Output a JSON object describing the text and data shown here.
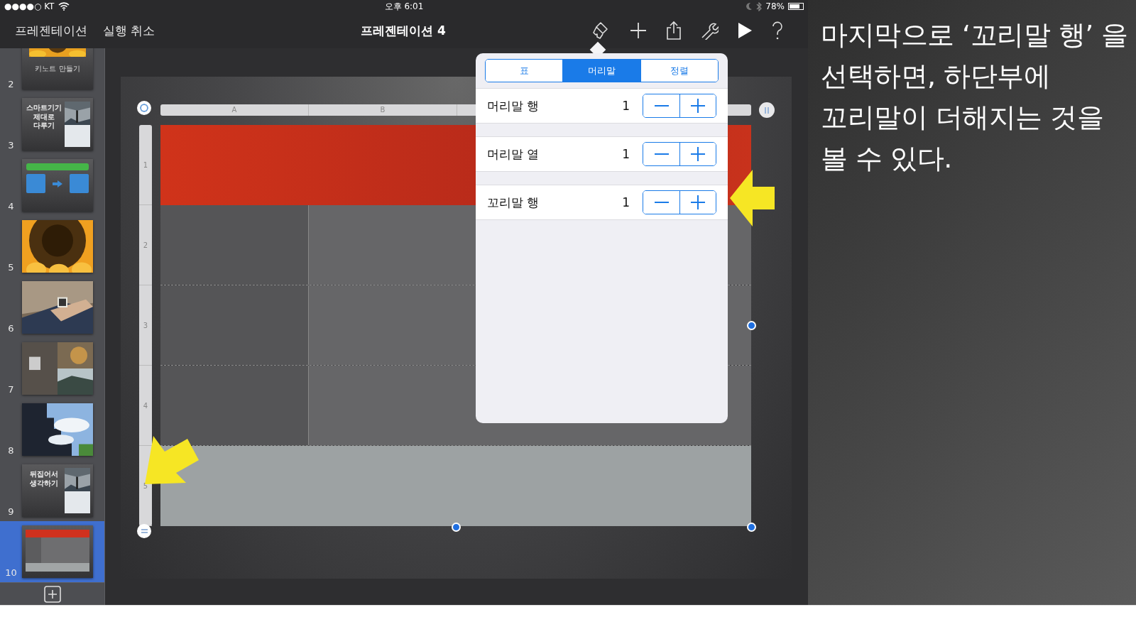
{
  "status_bar": {
    "carrier": "●●●●○ KT",
    "time": "오후 6:01",
    "battery": "78%"
  },
  "nav": {
    "buttons": [
      "프레젠테이션",
      "실행 취소"
    ],
    "title": "프레젠테이션 4"
  },
  "slides": [
    {
      "number": "2",
      "kind": "picture-caption",
      "title": "키노트 만들기",
      "selected": false
    },
    {
      "number": "3",
      "kind": "text-picture",
      "title": "스마트기기 제대로 다루기",
      "selected": false
    },
    {
      "number": "4",
      "kind": "diagram",
      "selected": false
    },
    {
      "number": "5",
      "kind": "picture",
      "selected": false
    },
    {
      "number": "6",
      "kind": "picture",
      "selected": false
    },
    {
      "number": "7",
      "kind": "picture",
      "selected": false
    },
    {
      "number": "8",
      "kind": "picture",
      "selected": false
    },
    {
      "number": "9",
      "kind": "text-picture",
      "title": "뒤집어서 생각하기",
      "selected": false
    },
    {
      "number": "10",
      "kind": "table",
      "selected": true
    }
  ],
  "table": {
    "columns": [
      "A",
      "B"
    ],
    "rows": [
      "1",
      "2",
      "3",
      "4",
      "5"
    ]
  },
  "popover": {
    "tabs": [
      {
        "label": "표",
        "selected": false
      },
      {
        "label": "머리말",
        "selected": true
      },
      {
        "label": "정렬",
        "selected": false
      }
    ],
    "rows": [
      {
        "label": "머리말 행",
        "value": "1"
      },
      {
        "label": "머리말 열",
        "value": "1"
      },
      {
        "label": "꼬리말 행",
        "value": "1"
      }
    ]
  },
  "annotation": "마지막으로 ‘꼬리말 행’ 을 선택하면, 하단부에 꼬리말이 더해지는 것을 볼 수 있다."
}
